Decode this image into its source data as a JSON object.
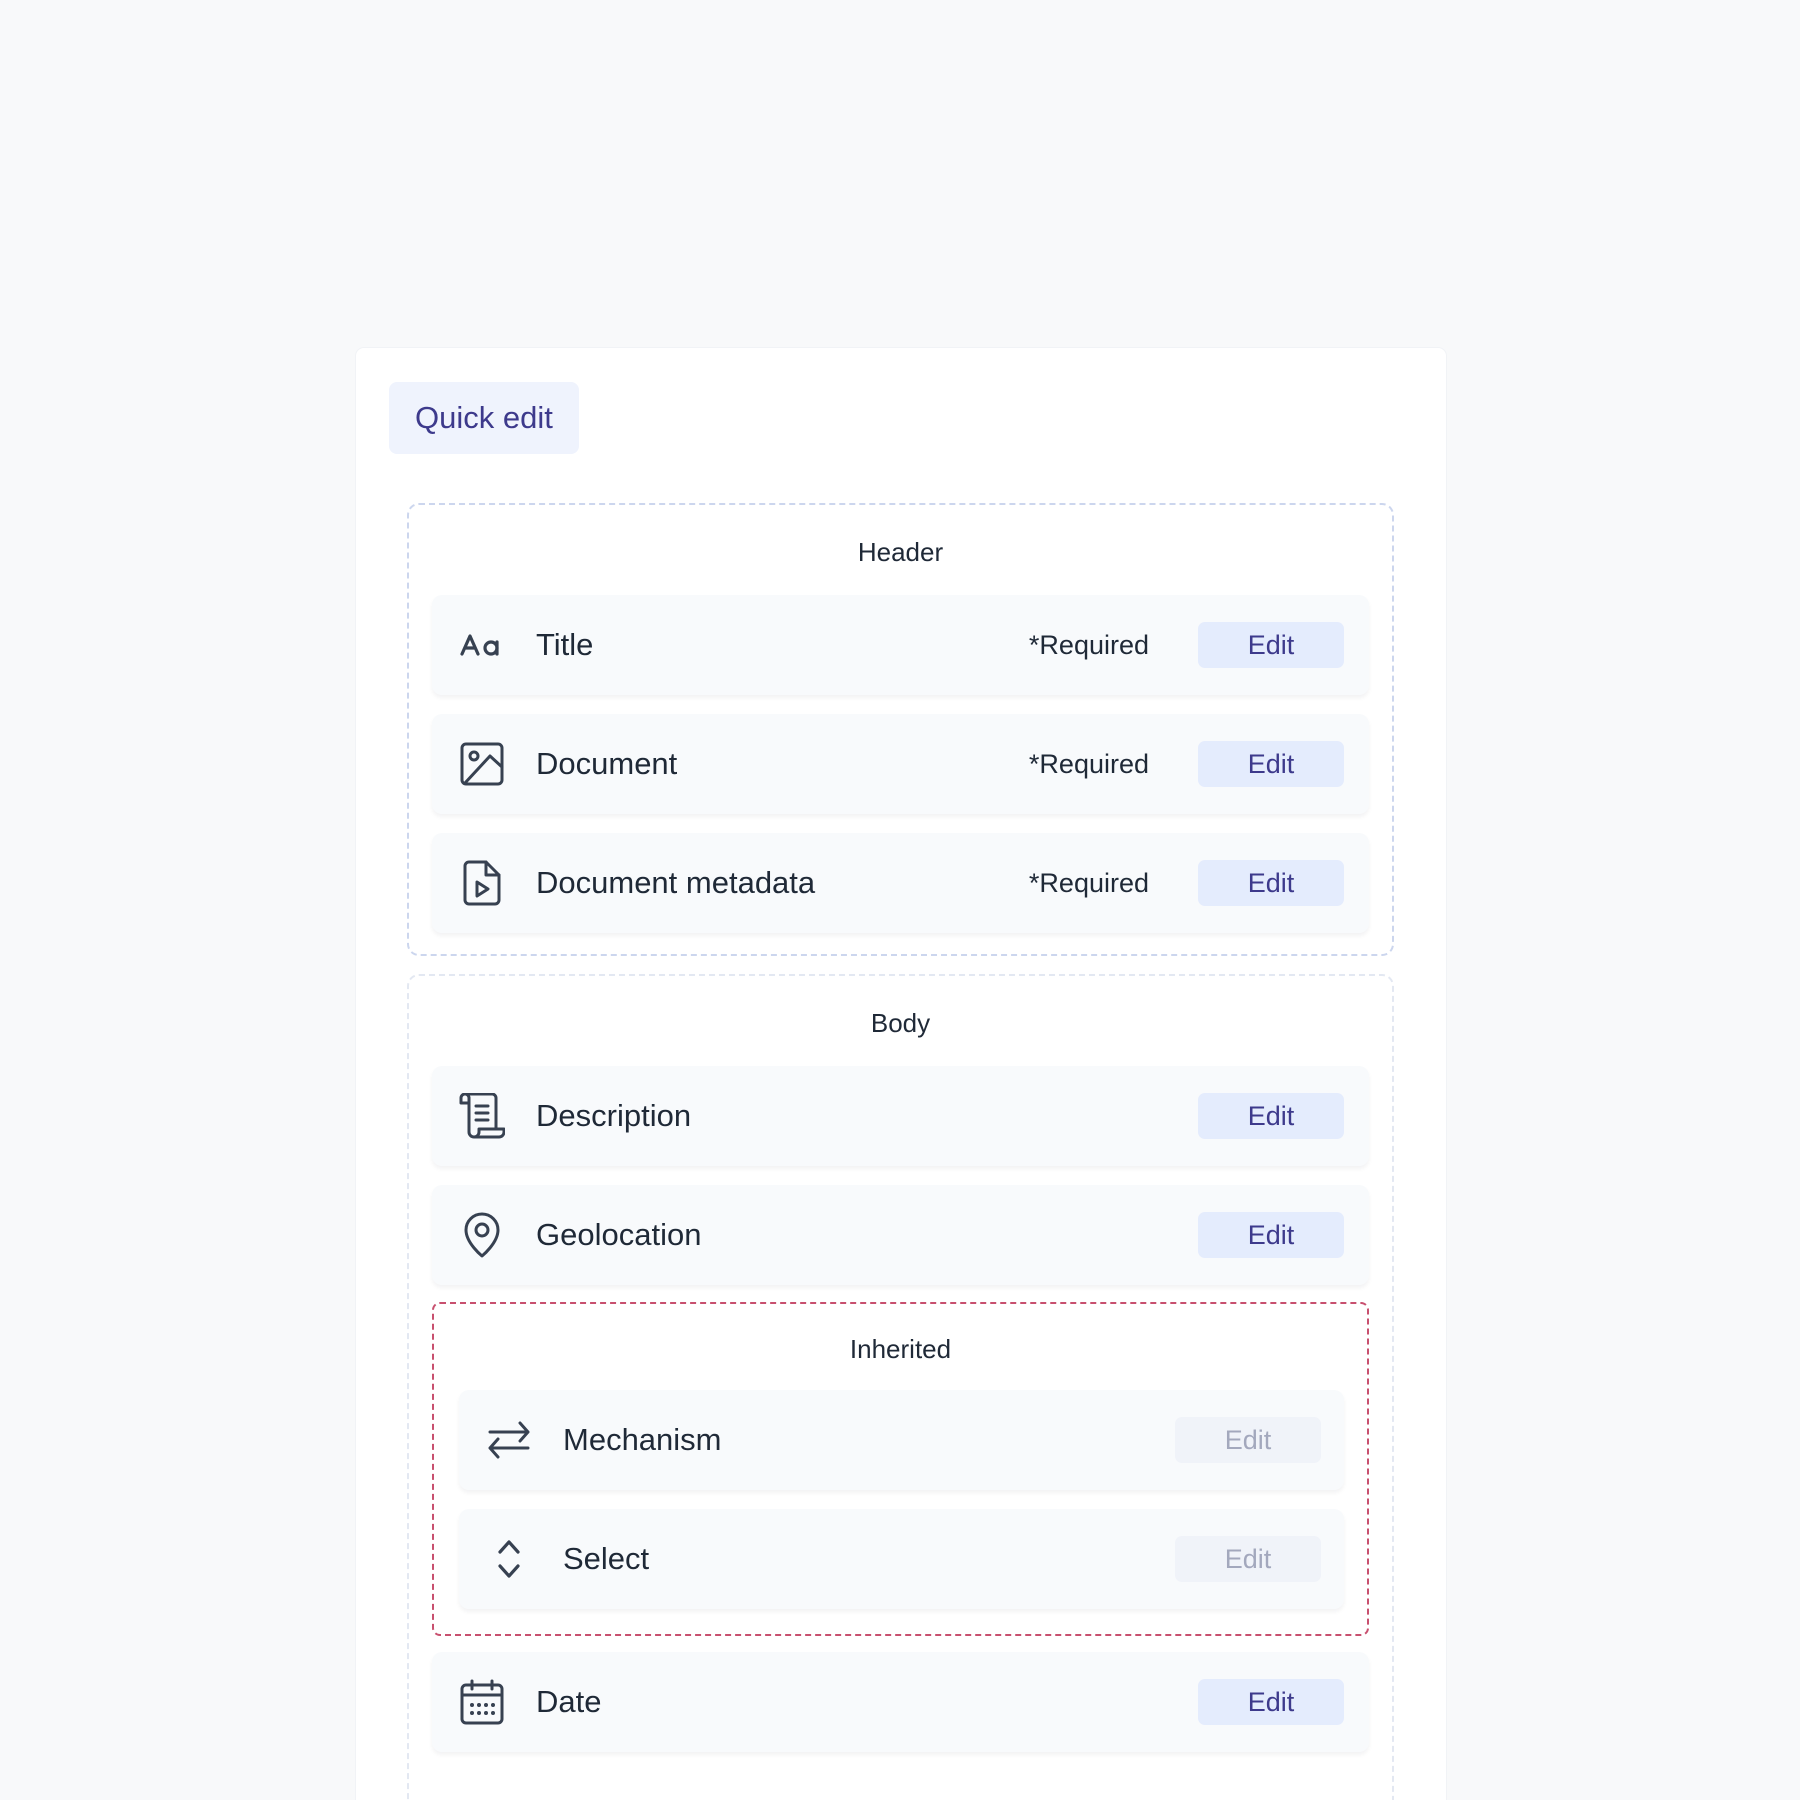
{
  "quick_edit_label": "Quick edit",
  "colors": {
    "accent": "#3d3a8c",
    "edit_button_bg": "#e4ecfd",
    "group_border": "#ccd6ee",
    "inherited_border": "#c8506f"
  },
  "header_group": {
    "title": "Header",
    "rows": [
      {
        "icon": "text-aa-icon",
        "label": "Title",
        "required": "*Required",
        "edit": "Edit"
      },
      {
        "icon": "image-icon",
        "label": "Document",
        "required": "*Required",
        "edit": "Edit"
      },
      {
        "icon": "file-play-icon",
        "label": "Document metadata",
        "required": "*Required",
        "edit": "Edit"
      }
    ]
  },
  "body_group": {
    "title": "Body",
    "rows": [
      {
        "icon": "scroll-icon",
        "label": "Description",
        "edit": "Edit"
      },
      {
        "icon": "map-pin-icon",
        "label": "Geolocation",
        "edit": "Edit"
      }
    ],
    "inherited": {
      "title": "Inherited",
      "rows": [
        {
          "icon": "arrows-swap-icon",
          "label": "Mechanism",
          "edit": "Edit",
          "disabled": true
        },
        {
          "icon": "chevrons-up-down-icon",
          "label": "Select",
          "edit": "Edit",
          "disabled": true
        }
      ]
    },
    "date_row": {
      "icon": "calendar-icon",
      "label": "Date",
      "edit": "Edit"
    }
  }
}
